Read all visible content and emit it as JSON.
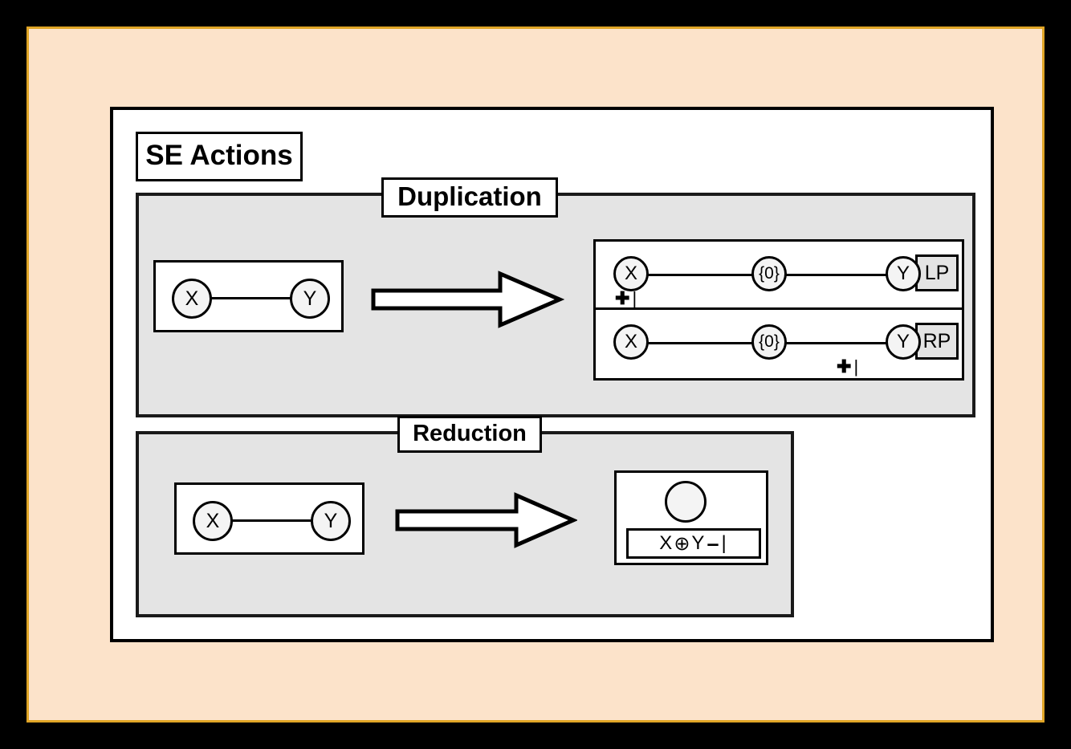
{
  "slide": {
    "border_color": "#E0A526",
    "background_color": "#FCE3CA",
    "outer_color": "#000000"
  },
  "card": {
    "title": "SE Actions",
    "background_color": "#FFFFFF"
  },
  "sections": [
    {
      "id": "duplication",
      "label": "Duplication",
      "panel_color": "#E4E4E4",
      "input": {
        "nodes": [
          {
            "id": "x",
            "label": "X"
          },
          {
            "id": "y",
            "label": "Y"
          }
        ],
        "edges": [
          {
            "from": "x",
            "to": "y"
          }
        ]
      },
      "arrow": "block-arrow-right",
      "output_rows": [
        {
          "tag": "LP",
          "nodes": [
            {
              "id": "x",
              "label": "X"
            },
            {
              "id": "zero",
              "label": "{0}"
            },
            {
              "id": "y",
              "label": "Y"
            }
          ],
          "edges": [
            {
              "from": "x",
              "to": "zero"
            },
            {
              "from": "zero",
              "to": "y"
            }
          ],
          "marker": {
            "plus": "✚",
            "bar": "|",
            "position": "left"
          }
        },
        {
          "tag": "RP",
          "nodes": [
            {
              "id": "x",
              "label": "X"
            },
            {
              "id": "zero",
              "label": "{0}"
            },
            {
              "id": "y",
              "label": "Y"
            }
          ],
          "edges": [
            {
              "from": "x",
              "to": "zero"
            },
            {
              "from": "zero",
              "to": "y"
            }
          ],
          "marker": {
            "plus": "✚",
            "bar": "|",
            "position": "right"
          }
        }
      ]
    },
    {
      "id": "reduction",
      "label": "Reduction",
      "panel_color": "#E4E4E4",
      "input": {
        "nodes": [
          {
            "id": "x",
            "label": "X"
          },
          {
            "id": "y",
            "label": "Y"
          }
        ],
        "edges": [
          {
            "from": "x",
            "to": "y"
          }
        ]
      },
      "arrow": "block-arrow-right",
      "output": {
        "merged_node": "",
        "formula": {
          "left": "X",
          "operator": "⊕",
          "right": "Y",
          "dash": "–",
          "bar": "|"
        }
      }
    }
  ]
}
